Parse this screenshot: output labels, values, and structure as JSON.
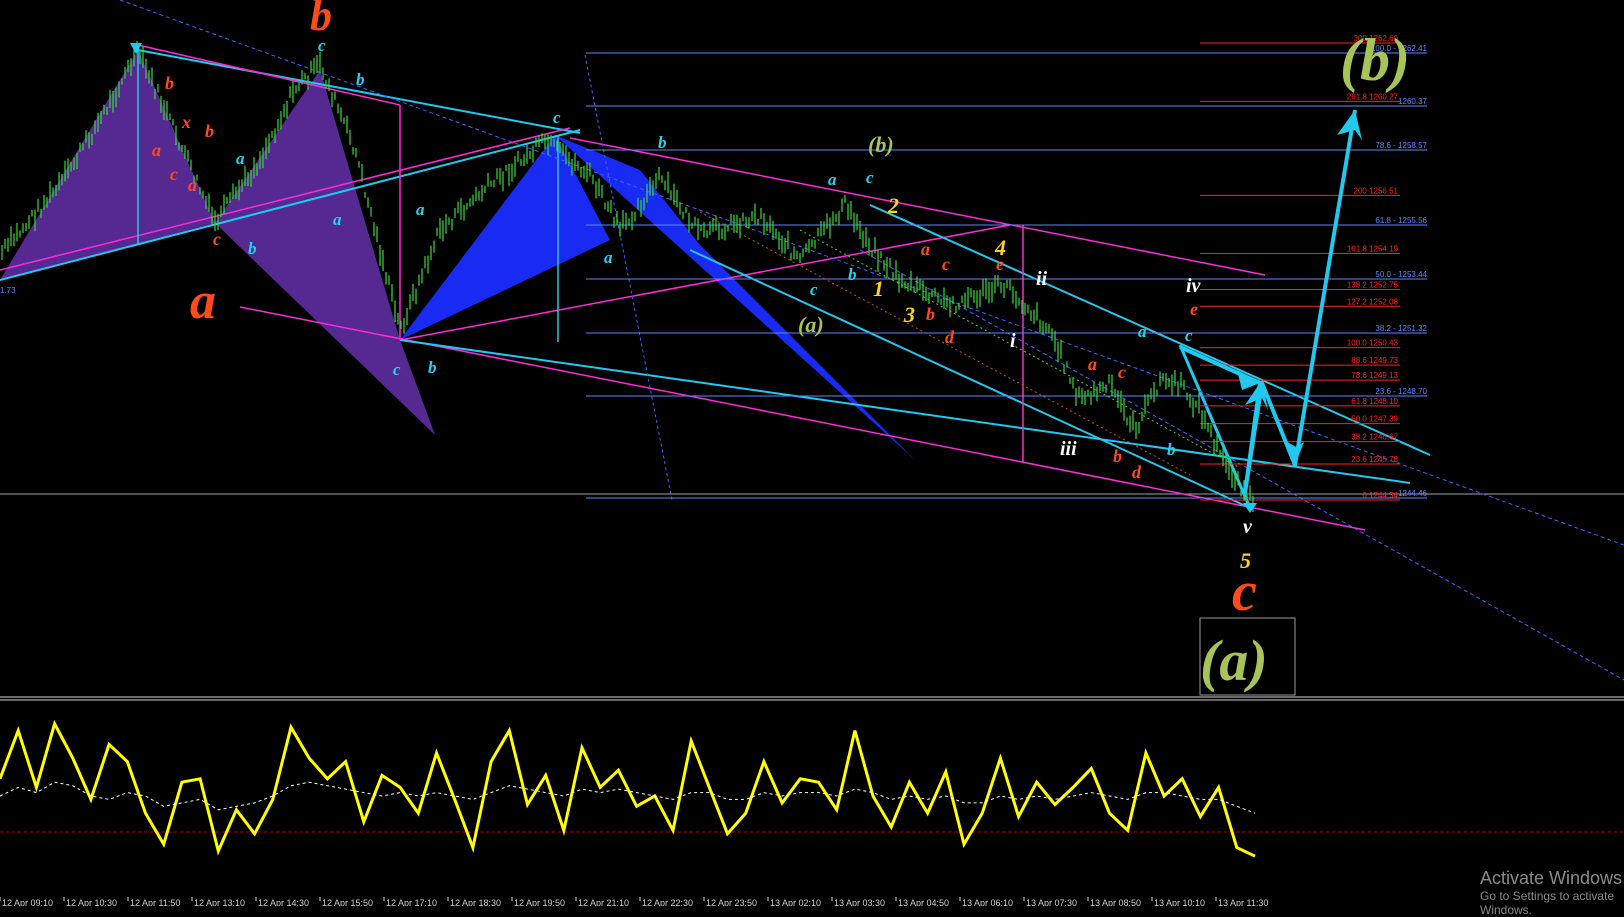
{
  "chart_data": {
    "type": "line",
    "title": "",
    "main_panel": {
      "price_tag_left": "1.73",
      "colors": {
        "background": "#000000",
        "price_bars": "#38d93c",
        "channel_magenta": "#ff2bd6",
        "trend_cyan": "#23c8ee",
        "fib_red": "#ff2020",
        "fib_blue": "#5b86ff",
        "pattern_purple": "#5a2a9a",
        "pattern_blue": "#1a2cff",
        "label_orange": "#ff4a1a",
        "label_cyan": "#27d3f0",
        "label_yellow": "#ffd21f",
        "label_olive": "#a7c45a",
        "label_white": "#ffffff"
      },
      "fib_levels_red": [
        {
          "ratio": "300",
          "price": "1262.60"
        },
        {
          "ratio": "261.8",
          "price": "1260.27"
        },
        {
          "ratio": "200",
          "price": "1256.51"
        },
        {
          "ratio": "161.8",
          "price": "1254.19"
        },
        {
          "ratio": "138.2",
          "price": "1252.75"
        },
        {
          "ratio": "127.2",
          "price": "1252.08"
        },
        {
          "ratio": "100.0",
          "price": "1250.43"
        },
        {
          "ratio": "88.6",
          "price": "1249.73"
        },
        {
          "ratio": "78.6",
          "price": "1249.13"
        },
        {
          "ratio": "61.8",
          "price": "1248.10"
        },
        {
          "ratio": "50.0",
          "price": "1247.39"
        },
        {
          "ratio": "38.2",
          "price": "1246.67"
        },
        {
          "ratio": "23.6",
          "price": "1245.78"
        },
        {
          "ratio": "0",
          "price": "1244.34"
        }
      ],
      "fib_levels_blue": [
        {
          "ratio": "100.0",
          "price": "1262.41"
        },
        {
          "ratio": "",
          "price": "1260.37"
        },
        {
          "ratio": "78.6",
          "price": "1258.57"
        },
        {
          "ratio": "61.8",
          "price": "1255.56"
        },
        {
          "ratio": "50.0",
          "price": "1253.44"
        },
        {
          "ratio": "38.2",
          "price": "1251.32"
        },
        {
          "ratio": "23.6",
          "price": "1248.70"
        },
        {
          "ratio": "",
          "price": "1244.46"
        }
      ],
      "wave_labels_big": {
        "a": "a",
        "b": "b",
        "c": "c",
        "a_box": "(a)",
        "b_target": "(b)"
      },
      "wave_labels_small": {
        "b_paren": "(b)",
        "a_paren": "(a)",
        "i": "i",
        "ii": "ii",
        "iii": "iii",
        "iv": "iv",
        "v": "v",
        "one": "1",
        "two": "2",
        "three": "3",
        "four": "4",
        "five": "5",
        "lc_a": "a",
        "lc_b": "b",
        "lc_c": "c",
        "lc_d": "d",
        "lc_e": "e",
        "lc_x": "x"
      }
    },
    "oscillator_panel": {
      "type": "line",
      "series": [
        {
          "color": "#ffff00",
          "values": [
            60,
            88,
            55,
            92,
            72,
            48,
            80,
            70,
            40,
            22,
            58,
            60,
            18,
            42,
            28,
            48,
            90,
            72,
            60,
            70,
            35,
            62,
            55,
            40,
            75,
            48,
            20,
            70,
            88,
            45,
            62,
            30,
            78,
            55,
            65,
            44,
            50,
            30,
            82,
            55,
            28,
            40,
            70,
            46,
            60,
            58,
            42,
            88,
            50,
            32,
            58,
            40,
            64,
            22,
            40,
            72,
            38,
            58,
            45,
            55,
            66,
            40,
            30,
            75,
            50,
            60,
            38,
            55,
            20,
            15
          ]
        },
        {
          "color": "#ffffff",
          "values": [
            50,
            55,
            52,
            58,
            56,
            50,
            48,
            52,
            50,
            44,
            46,
            48,
            42,
            44,
            46,
            50,
            56,
            58,
            56,
            54,
            52,
            50,
            52,
            50,
            52,
            50,
            48,
            52,
            56,
            54,
            52,
            50,
            54,
            52,
            54,
            52,
            50,
            48,
            52,
            52,
            48,
            48,
            52,
            50,
            52,
            52,
            50,
            54,
            52,
            48,
            50,
            48,
            50,
            46,
            46,
            50,
            48,
            50,
            48,
            50,
            52,
            50,
            48,
            52,
            52,
            50,
            48,
            48,
            44,
            40
          ]
        }
      ],
      "ylim": [
        0,
        100
      ]
    },
    "time_labels": [
      "12 Apr 09:10",
      "12 Apr 10:30",
      "12 Apr 11:50",
      "12 Apr 13:10",
      "12 Apr 14:30",
      "12 Apr 15:50",
      "12 Apr 17:10",
      "12 Apr 18:30",
      "12 Apr 19:50",
      "12 Apr 21:10",
      "12 Apr 22:30",
      "12 Apr 23:50",
      "13 Apr 02:10",
      "13 Apr 03:30",
      "13 Apr 04:50",
      "13 Apr 06:10",
      "13 Apr 07:30",
      "13 Apr 08:50",
      "13 Apr 10:10",
      "13 Apr 11:30"
    ]
  },
  "watermark": {
    "title": "Activate Windows",
    "subtitle": "Go to Settings to activate Windows."
  }
}
